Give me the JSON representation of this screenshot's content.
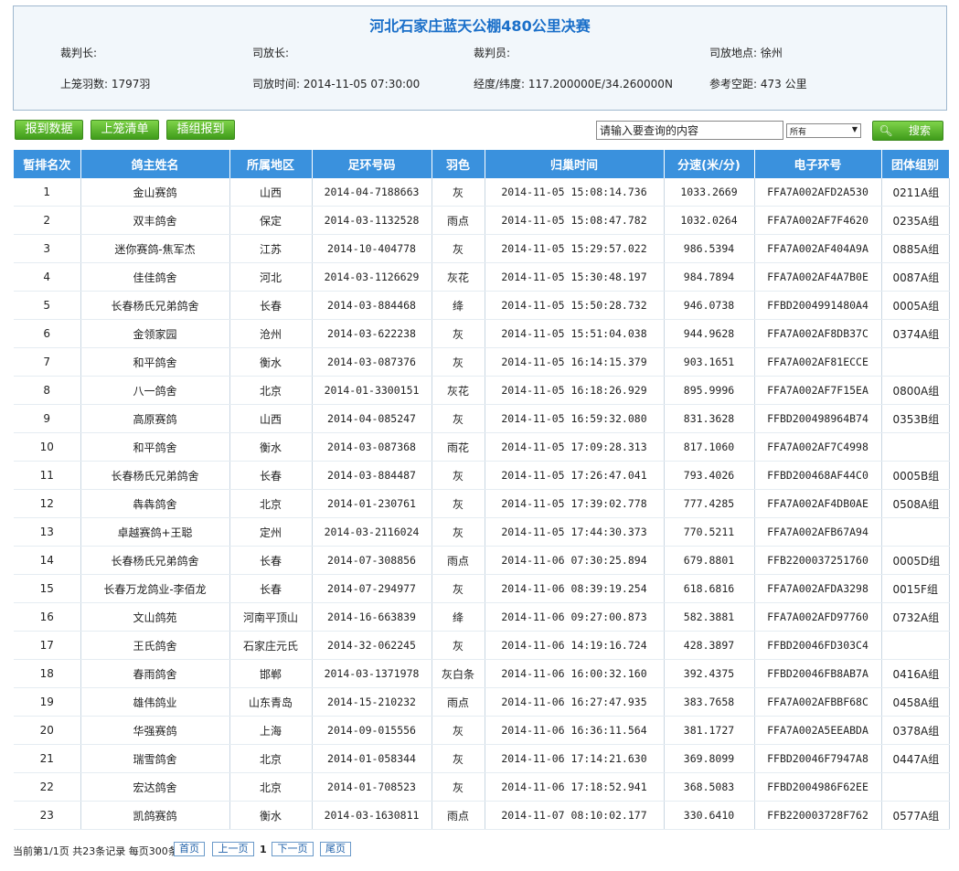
{
  "title": "河北石家庄蓝天公棚480公里决赛",
  "info": {
    "row1": [
      "裁判长:",
      "司放长:",
      "裁判员:",
      "司放地点: 徐州"
    ],
    "row2": [
      "上笼羽数: 1797羽",
      "司放时间: 2014-11-05 07:30:00",
      "经度/纬度: 117.200000E/34.260000N",
      "参考空距: 473 公里"
    ]
  },
  "toolbar": {
    "buttons": [
      "报到数据",
      "上笼清单",
      "插组报到"
    ],
    "search_value": "请输入要查询的内容",
    "select_value": "所有",
    "search_label": "搜索"
  },
  "table": {
    "headers": [
      "暂排名次",
      "鸽主姓名",
      "所属地区",
      "足环号码",
      "羽色",
      "归巢时间",
      "分速(米/分)",
      "电子环号",
      "团体组别"
    ],
    "rows": [
      [
        "1",
        "金山赛鸽",
        "山西",
        "2014-04-7188663",
        "灰",
        "2014-11-05 15:08:14.736",
        "1033.2669",
        "FFA7A002AFD2A530",
        "0211A组"
      ],
      [
        "2",
        "双丰鸽舍",
        "保定",
        "2014-03-1132528",
        "雨点",
        "2014-11-05 15:08:47.782",
        "1032.0264",
        "FFA7A002AF7F4620",
        "0235A组"
      ],
      [
        "3",
        "迷你赛鸽-焦军杰",
        "江苏",
        "2014-10-404778",
        "灰",
        "2014-11-05 15:29:57.022",
        "986.5394",
        "FFA7A002AF404A9A",
        "0885A组"
      ],
      [
        "4",
        "佳佳鸽舍",
        "河北",
        "2014-03-1126629",
        "灰花",
        "2014-11-05 15:30:48.197",
        "984.7894",
        "FFA7A002AF4A7B0E",
        "0087A组"
      ],
      [
        "5",
        "长春杨氏兄弟鸽舍",
        "长春",
        "2014-03-884468",
        "绛",
        "2014-11-05 15:50:28.732",
        "946.0738",
        "FFBD2004991480A4",
        "0005A组"
      ],
      [
        "6",
        "金领家园",
        "沧州",
        "2014-03-622238",
        "灰",
        "2014-11-05 15:51:04.038",
        "944.9628",
        "FFA7A002AF8DB37C",
        "0374A组"
      ],
      [
        "7",
        "和平鸽舍",
        "衡水",
        "2014-03-087376",
        "灰",
        "2014-11-05 16:14:15.379",
        "903.1651",
        "FFA7A002AF81ECCE",
        ""
      ],
      [
        "8",
        "八一鸽舍",
        "北京",
        "2014-01-3300151",
        "灰花",
        "2014-11-05 16:18:26.929",
        "895.9996",
        "FFA7A002AF7F15EA",
        "0800A组"
      ],
      [
        "9",
        "高原赛鸽",
        "山西",
        "2014-04-085247",
        "灰",
        "2014-11-05 16:59:32.080",
        "831.3628",
        "FFBD200498964B74",
        "0353B组"
      ],
      [
        "10",
        "和平鸽舍",
        "衡水",
        "2014-03-087368",
        "雨花",
        "2014-11-05 17:09:28.313",
        "817.1060",
        "FFA7A002AF7C4998",
        ""
      ],
      [
        "11",
        "长春杨氏兄弟鸽舍",
        "长春",
        "2014-03-884487",
        "灰",
        "2014-11-05 17:26:47.041",
        "793.4026",
        "FFBD200468AF44C0",
        "0005B组"
      ],
      [
        "12",
        "犇犇鸽舍",
        "北京",
        "2014-01-230761",
        "灰",
        "2014-11-05 17:39:02.778",
        "777.4285",
        "FFA7A002AF4DB0AE",
        "0508A组"
      ],
      [
        "13",
        "卓越赛鸽+王聪",
        "定州",
        "2014-03-2116024",
        "灰",
        "2014-11-05 17:44:30.373",
        "770.5211",
        "FFA7A002AFB67A94",
        ""
      ],
      [
        "14",
        "长春杨氏兄弟鸽舍",
        "长春",
        "2014-07-308856",
        "雨点",
        "2014-11-06 07:30:25.894",
        "679.8801",
        "FFB2200037251760",
        "0005D组"
      ],
      [
        "15",
        "长春万龙鸽业-李佰龙",
        "长春",
        "2014-07-294977",
        "灰",
        "2014-11-06 08:39:19.254",
        "618.6816",
        "FFA7A002AFDA3298",
        "0015F组"
      ],
      [
        "16",
        "文山鸽苑",
        "河南平顶山",
        "2014-16-663839",
        "绛",
        "2014-11-06 09:27:00.873",
        "582.3881",
        "FFA7A002AFD97760",
        "0732A组"
      ],
      [
        "17",
        "王氏鸽舍",
        "石家庄元氏",
        "2014-32-062245",
        "灰",
        "2014-11-06 14:19:16.724",
        "428.3897",
        "FFBD20046FD303C4",
        ""
      ],
      [
        "18",
        "春雨鸽舍",
        "邯郸",
        "2014-03-1371978",
        "灰白条",
        "2014-11-06 16:00:32.160",
        "392.4375",
        "FFBD20046FB8AB7A",
        "0416A组"
      ],
      [
        "19",
        "雄伟鸽业",
        "山东青岛",
        "2014-15-210232",
        "雨点",
        "2014-11-06 16:27:47.935",
        "383.7658",
        "FFA7A002AFBBF68C",
        "0458A组"
      ],
      [
        "20",
        "华强赛鸽",
        "上海",
        "2014-09-015556",
        "灰",
        "2014-11-06 16:36:11.564",
        "381.1727",
        "FFA7A002A5EEABDA",
        "0378A组"
      ],
      [
        "21",
        "瑞雪鸽舍",
        "北京",
        "2014-01-058344",
        "灰",
        "2014-11-06 17:14:21.630",
        "369.8099",
        "FFBD20046F7947A8",
        "0447A组"
      ],
      [
        "22",
        "宏达鸽舍",
        "北京",
        "2014-01-708523",
        "灰",
        "2014-11-06 17:18:52.941",
        "368.5083",
        "FFBD2004986F62EE",
        ""
      ],
      [
        "23",
        "凯鸽赛鸽",
        "衡水",
        "2014-03-1630811",
        "雨点",
        "2014-11-07 08:10:02.177",
        "330.6410",
        "FFB220003728F762",
        "0577A组"
      ]
    ]
  },
  "pager": {
    "summary": "当前第1/1页 共23条记录 每页300条",
    "first": "首页",
    "prev": "上一页",
    "current": "1",
    "next": "下一页",
    "last": "尾页"
  }
}
